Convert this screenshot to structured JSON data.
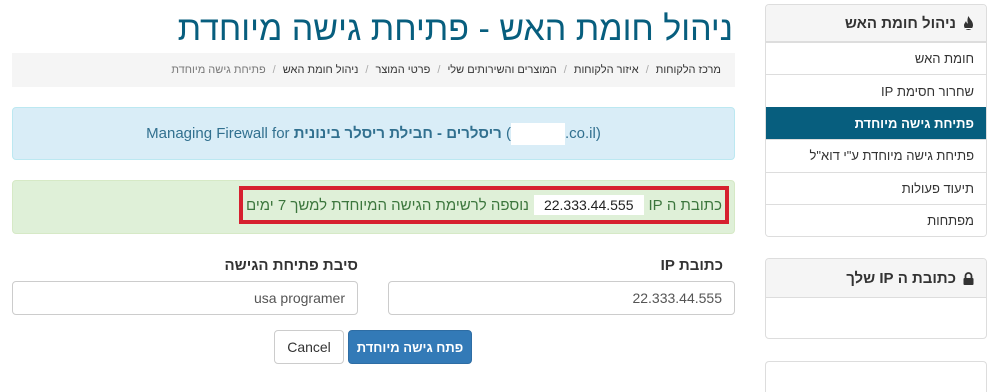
{
  "page": {
    "title": "ניהול חומת האש - פתיחת גישה מיוחדת"
  },
  "breadcrumb": [
    "מרכז הלקוחות",
    "איזור הלקוחות",
    "המוצרים והשירותים שלי",
    "פרטי המוצר",
    "ניהול חומת האש",
    "פתיחת גישה מיוחדת"
  ],
  "info_alert": {
    "prefix": "Managing Firewall for",
    "reseller": "ריסלרים - חבילת ריסלר בינונית",
    "domain_suffix": ".co.il)",
    "open_paren": "("
  },
  "success_alert": {
    "before_ip": "כתובת ה IP",
    "ip": "22.333.44.555",
    "after_ip": "נוספה לרשימת הגישה המיוחדת למשך 7 ימים"
  },
  "form": {
    "ip_label": "כתובת IP",
    "ip_value": "22.333.44.555",
    "reason_label": "סיבת פתיחת הגישה",
    "reason_value": "usa programer",
    "submit_label": "פתח גישה מיוחדת",
    "cancel_label": "Cancel"
  },
  "sidebar": {
    "heading": "ניהול חומת האש",
    "items": [
      "חומת האש",
      "שחרור חסימת IP",
      "פתיחת גישה מיוחדת",
      "פתיחת גישה מיוחדת ע\"י דוא\"ל",
      "תיעוד פעולות",
      "מפתחות"
    ],
    "active_index": 2,
    "ip_heading": "כתובת ה IP שלך"
  },
  "colors": {
    "brand": "#075e7e",
    "primary_button": "#337ab7",
    "highlight_border": "#d6202f"
  }
}
